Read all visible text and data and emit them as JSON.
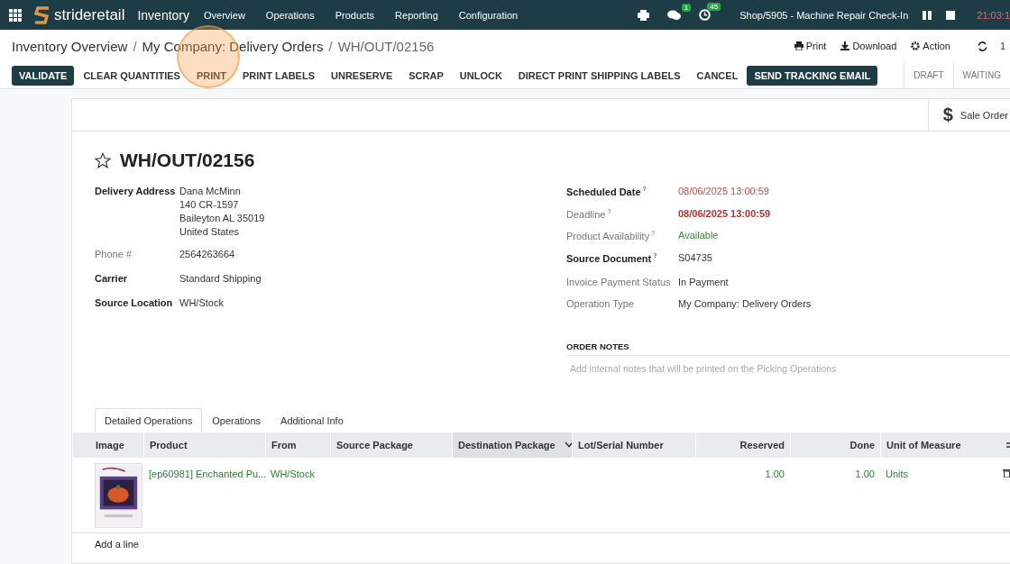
{
  "topbar": {
    "brand": "strideretail",
    "app": "Inventory",
    "menu": [
      "Overview",
      "Operations",
      "Products",
      "Reporting",
      "Configuration"
    ],
    "messages_badge": "1",
    "activities_badge": "45",
    "session": "Shop/5905 - Machine Repair Check-In",
    "time": "21:03:1"
  },
  "breadcrumb": {
    "items": [
      {
        "label": "Inventory Overview",
        "sep": "/"
      },
      {
        "label": "My Company: Delivery Orders",
        "sep": "/"
      }
    ],
    "current": "WH/OUT/02156"
  },
  "actions": [
    "Print",
    "Download",
    "Action"
  ],
  "pager": "1",
  "buttons": [
    {
      "label": "VALIDATE",
      "primary": true
    },
    {
      "label": "CLEAR QUANTITIES",
      "primary": false
    },
    {
      "label": "PRINT",
      "primary": false
    },
    {
      "label": "PRINT LABELS",
      "primary": false
    },
    {
      "label": "UNRESERVE",
      "primary": false
    },
    {
      "label": "SCRAP",
      "primary": false
    },
    {
      "label": "UNLOCK",
      "primary": false
    },
    {
      "label": "DIRECT PRINT SHIPPING LABELS",
      "primary": false
    },
    {
      "label": "CANCEL",
      "primary": false
    },
    {
      "label": "SEND TRACKING EMAIL",
      "primary": true
    }
  ],
  "statusbar": [
    {
      "label": "DRAFT",
      "selected": false
    },
    {
      "label": "WAITING",
      "selected": false
    }
  ],
  "smart_button": {
    "glyph": "$",
    "label": "Sale Order"
  },
  "record": {
    "title": "WH/OUT/02156",
    "starred": false
  },
  "left_fields": [
    {
      "label": "Delivery Address",
      "strong": true,
      "lines": [
        "Dana McMinn",
        "140 CR-1597",
        "Baileyton AL 35019",
        "United States"
      ]
    },
    {
      "label": "Phone #",
      "strong": false,
      "lines": [
        "2564263664"
      ]
    },
    {
      "label": "Carrier",
      "strong": true,
      "lines": [
        "Standard Shipping"
      ]
    },
    {
      "label": "Source Location",
      "strong": true,
      "lines": [
        "WH/Stock"
      ]
    }
  ],
  "right_fields": [
    {
      "label": "Scheduled Date",
      "strong": true,
      "help": "?",
      "value": "08/06/2025 13:00:59",
      "color": "#c0504d",
      "bold": false
    },
    {
      "label": "Deadline",
      "strong": false,
      "help": "?",
      "value": "08/06/2025 13:00:59",
      "color": "#b83232",
      "bold": true
    },
    {
      "label": "Product Availability",
      "strong": false,
      "help": "?",
      "value": "Available",
      "color": "#3a8a3a",
      "bold": false
    },
    {
      "label": "Source Document",
      "strong": true,
      "help": "?",
      "value": "S04735",
      "color": "#333333",
      "bold": false
    },
    {
      "label": "Invoice Payment Status",
      "strong": false,
      "value": "In Payment",
      "color": "#333333",
      "bold": false
    },
    {
      "label": "Operation Type",
      "strong": false,
      "value": "My Company: Delivery Orders",
      "color": "#333333",
      "bold": false
    }
  ],
  "order_notes": {
    "heading": "ORDER NOTES",
    "placeholder": "Add internal notes that will be printed on the Picking Operations"
  },
  "tabs": [
    {
      "label": "Detailed Operations",
      "selected": true
    },
    {
      "label": "Operations",
      "selected": false
    },
    {
      "label": "Additional Info",
      "selected": false
    }
  ],
  "table": {
    "columns": [
      {
        "label": "Image",
        "kind": "text",
        "sorted": false
      },
      {
        "label": "Product",
        "kind": "text",
        "sorted": false
      },
      {
        "label": "From",
        "kind": "text",
        "sorted": false
      },
      {
        "label": "Source Package",
        "kind": "text",
        "sorted": false
      },
      {
        "label": "Destination Package",
        "kind": "text",
        "sorted": true
      },
      {
        "label": "Lot/Serial Number",
        "kind": "text",
        "sorted": false
      },
      {
        "label": "Reserved",
        "kind": "number",
        "sorted": false
      },
      {
        "label": "Done",
        "kind": "number",
        "sorted": false
      },
      {
        "label": "Unit of Measure",
        "kind": "text",
        "sorted": false
      }
    ],
    "rows": [
      {
        "cells": [
          {
            "kind": "picture"
          },
          {
            "kind": "text",
            "text": "[ep60981] Enchanted Pu..."
          },
          {
            "kind": "text",
            "text": "WH/Stock"
          },
          {
            "kind": "empty"
          },
          {
            "kind": "empty"
          },
          {
            "kind": "empty"
          },
          {
            "kind": "text",
            "text": "1.00"
          },
          {
            "kind": "text",
            "text": "1.00"
          },
          {
            "kind": "text",
            "text": "Units"
          }
        ]
      }
    ],
    "add_line": "Add a line"
  }
}
